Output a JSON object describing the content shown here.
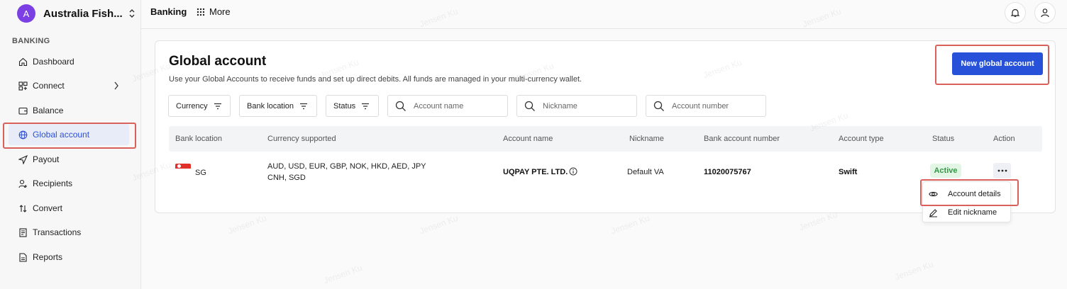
{
  "org": {
    "initial": "A",
    "name": "Australia Fish..."
  },
  "sidebar": {
    "section": "BANKING",
    "items": [
      {
        "label": "Dashboard",
        "icon": "home-icon"
      },
      {
        "label": "Connect",
        "icon": "connect-icon"
      },
      {
        "label": "Balance",
        "icon": "balance-icon"
      },
      {
        "label": "Global account",
        "icon": "globe-icon",
        "active": true
      },
      {
        "label": "Payout",
        "icon": "send-icon"
      },
      {
        "label": "Recipients",
        "icon": "recipients-icon"
      },
      {
        "label": "Convert",
        "icon": "convert-icon"
      },
      {
        "label": "Transactions",
        "icon": "transactions-icon"
      },
      {
        "label": "Reports",
        "icon": "reports-icon"
      }
    ]
  },
  "topbar": {
    "banking": "Banking",
    "more": "More"
  },
  "page": {
    "title": "Global account",
    "subtitle": "Use your Global Accounts to receive funds and set up direct debits. All funds are managed in your multi-currency wallet.",
    "new_button": "New global account"
  },
  "filters": {
    "currency": "Currency",
    "bank_location": "Bank location",
    "status": "Status"
  },
  "search": {
    "account_name": "Account name",
    "nickname": "Nickname",
    "account_number": "Account number"
  },
  "table": {
    "headers": [
      "Bank location",
      "Currency supported",
      "Account name",
      "Nickname",
      "Bank account number",
      "Account type",
      "Status",
      "Action"
    ],
    "rows": [
      {
        "bank_location": "SG",
        "currencies_line1": "AUD, USD, EUR, GBP, NOK, HKD, AED, JPY",
        "currencies_line2": "CNH, SGD",
        "account_name": "UQPAY PTE. LTD.",
        "nickname": "Default VA",
        "account_number": "11020075767",
        "account_type": "Swift",
        "status": "Active"
      }
    ]
  },
  "action_menu": {
    "items": [
      "Account details",
      "Edit nickname"
    ]
  },
  "watermark": "Jensen Ku",
  "colors": {
    "primary": "#2651d8",
    "highlight": "#d9605b",
    "active_bg": "#e8ecf8",
    "status_green": "#2f9a43"
  }
}
